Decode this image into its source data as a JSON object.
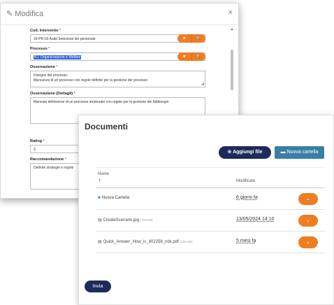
{
  "modal": {
    "title": "Modifica",
    "close": "×",
    "fields": {
      "cod_intervento": {
        "label": "Cod. Intervento",
        "value": "19-PR-03 Audit Selezione del personale"
      },
      "processo": {
        "label": "Processo",
        "value": "B.I. Organizzazione e Welfare"
      },
      "osservazione": {
        "label": "Osservazione",
        "value_line1": "Disegno del processo",
        "value_line2": "Mancanza di un processo con regole definite per la gestione del processo"
      },
      "osservazione_dettagli": {
        "label": "Osservazione (Dettagli)",
        "value": "Mancata definizione di un processo strutturato con regole per la gestione dei fabbisogni"
      },
      "rating": {
        "label": "Rating",
        "value": "3"
      },
      "raccomandazione": {
        "label": "Raccomandazione",
        "value": "Definire strategie e regole"
      }
    },
    "required_mark": "*",
    "btn_clear": "✖",
    "btn_search": "🔍"
  },
  "docs": {
    "title": "Documenti",
    "upload_label": "Aggiungi file",
    "new_folder_label": "Nuova cartella",
    "col_name": "Nome",
    "col_modified": "Modificato",
    "sort_icon": "🡑",
    "rows": [
      {
        "type": "folder",
        "name": "Nuova Cartella",
        "size": "",
        "modified": "6 giorni fa"
      },
      {
        "type": "file",
        "name": "CreateScenario.jpg",
        "size": "(793 KB)",
        "modified": "13/05/2024 14:10"
      },
      {
        "type": "file",
        "name": "Quick_Answer_How_is_802258_ndx.pdf",
        "size": "(233 KB)",
        "modified": "5 mesi fa"
      }
    ],
    "submit_label": "Invia"
  }
}
